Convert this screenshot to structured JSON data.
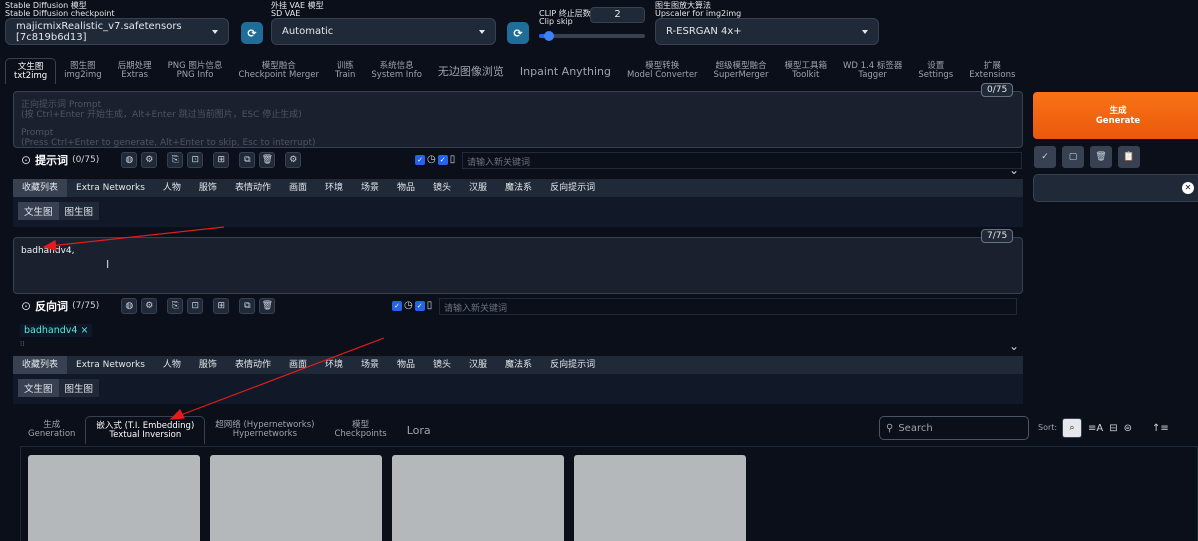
{
  "top": {
    "checkpoint": {
      "label_cn": "Stable Diffusion 模型",
      "label_en": "Stable Diffusion checkpoint",
      "value": "majicmixRealistic_v7.safetensors [7c819b6d13]"
    },
    "vae": {
      "label_cn": "外挂 VAE 模型",
      "label_en": "SD VAE",
      "value": "Automatic"
    },
    "clip": {
      "label_cn": "CLIP 终止层数",
      "label_en": "Clip skip",
      "value": "2",
      "slider_fraction": 0.08
    },
    "upscaler": {
      "label_cn": "图生图放大算法",
      "label_en": "Upscaler for img2img",
      "value": "R-ESRGAN 4x+"
    }
  },
  "tabs": [
    {
      "cn": "文生图",
      "en": "txt2img"
    },
    {
      "cn": "图生图",
      "en": "img2img"
    },
    {
      "cn": "后期处理",
      "en": "Extras"
    },
    {
      "cn": "PNG 图片信息",
      "en": "PNG Info"
    },
    {
      "cn": "模型融合",
      "en": "Checkpoint Merger"
    },
    {
      "cn": "训练",
      "en": "Train"
    },
    {
      "cn": "系统信息",
      "en": "System Info"
    },
    {
      "cn": "无边图像浏览",
      "en": ""
    },
    {
      "cn": "Inpaint Anything",
      "en": ""
    },
    {
      "cn": "模型转换",
      "en": "Model Converter"
    },
    {
      "cn": "超级模型融合",
      "en": "SuperMerger"
    },
    {
      "cn": "模型工具箱",
      "en": "Toolkit"
    },
    {
      "cn": "WD 1.4 标签器",
      "en": "Tagger"
    },
    {
      "cn": "设置",
      "en": "Settings"
    },
    {
      "cn": "扩展",
      "en": "Extensions"
    }
  ],
  "prompt": {
    "counter": "0/75",
    "placeholder_l1": "正向提示词 Prompt",
    "placeholder_l2": "(按 Ctrl+Enter 开始生成，Alt+Enter 跳过当前图片，ESC 停止生成)",
    "placeholder_l3": "Prompt",
    "placeholder_l4": "(Press Ctrl+Enter to generate, Alt+Enter to skip, Esc to interrupt)",
    "toolbar_label": "提示词",
    "toolbar_count": "(0/75)",
    "keyword_placeholder": "请输入新关键词"
  },
  "negative": {
    "counter": "7/75",
    "value": "badhandv4,",
    "toolbar_label": "反向词",
    "toolbar_count": "(7/75)",
    "keyword_placeholder": "请输入新关键词",
    "tag": "badhandv4 ×"
  },
  "categories": [
    "收藏列表",
    "Extra Networks",
    "人物",
    "服饰",
    "表情动作",
    "画面",
    "环境",
    "场景",
    "物品",
    "镜头",
    "汉服",
    "魔法系",
    "反向提示词"
  ],
  "sub_tabs": [
    "文生图",
    "图生图"
  ],
  "generate": {
    "cn": "生成",
    "en": "Generate"
  },
  "network_tabs": [
    {
      "cn": "生成",
      "en": "Generation"
    },
    {
      "cn": "嵌入式 (T.I. Embedding)",
      "en": "Textual Inversion"
    },
    {
      "cn": "超网络 (Hypernetworks)",
      "en": "Hypernetworks"
    },
    {
      "cn": "模型",
      "en": "Checkpoints"
    },
    {
      "cn": "Lora",
      "en": ""
    }
  ],
  "search": {
    "placeholder": "Search"
  },
  "sort_label": "Sort:",
  "colors": {
    "accent_orange": "#ea580c",
    "bg": "#0b0f19",
    "arrow": "#e11d1d"
  }
}
